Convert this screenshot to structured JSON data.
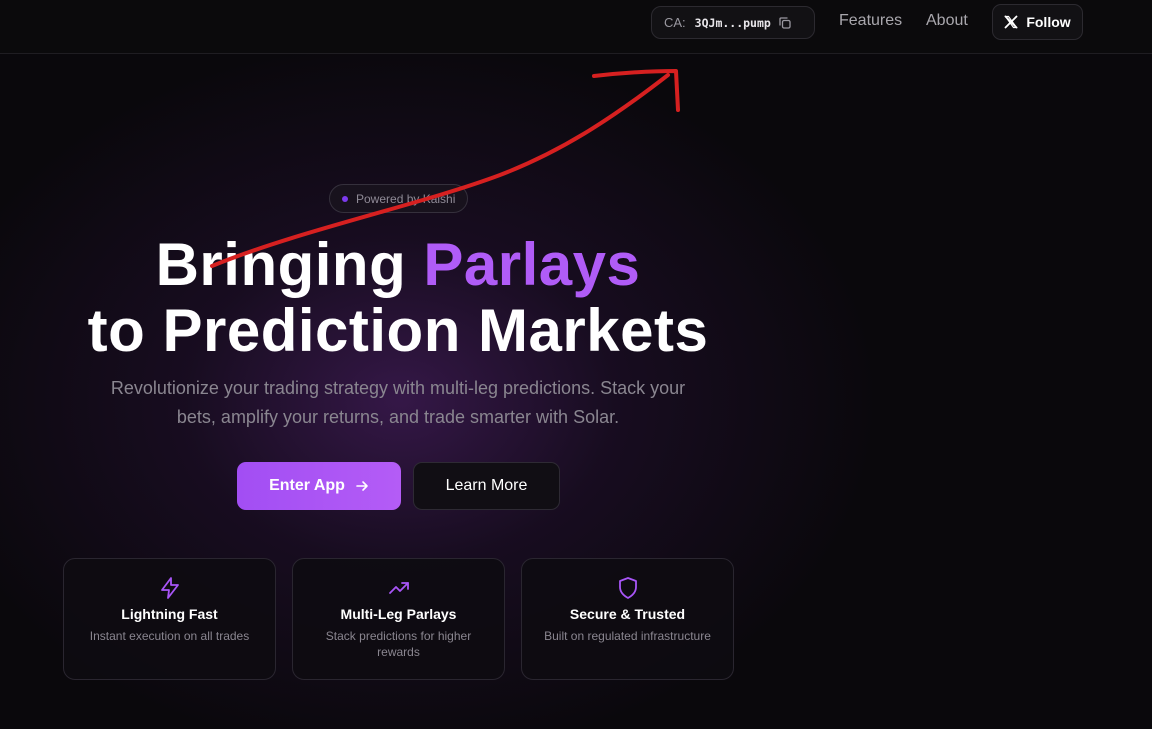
{
  "nav": {
    "ca_label": "CA:",
    "ca_value": "3QJm...pump",
    "links": [
      "Features",
      "About"
    ],
    "follow_label": "Follow"
  },
  "hero": {
    "badge": "Powered by Kalshi",
    "title_line1_plain": "Bringing ",
    "title_line1_accent": "Parlays",
    "title_line2": "to Prediction Markets",
    "subtitle": "Revolutionize your trading strategy with multi-leg predictions. Stack your bets, amplify your returns, and trade smarter with Solar.",
    "primary_cta": "Enter App",
    "secondary_cta": "Learn More"
  },
  "features": [
    {
      "icon": "lightning-icon",
      "title": "Lightning Fast",
      "desc": "Instant execution on all trades"
    },
    {
      "icon": "trending-up-icon",
      "title": "Multi-Leg Parlays",
      "desc": "Stack predictions for higher rewards"
    },
    {
      "icon": "shield-icon",
      "title": "Secure & Trusted",
      "desc": "Built on regulated infrastructure"
    }
  ],
  "colors": {
    "accent": "#b05cf7",
    "annotation": "#d62020",
    "background": "#0a080c"
  }
}
